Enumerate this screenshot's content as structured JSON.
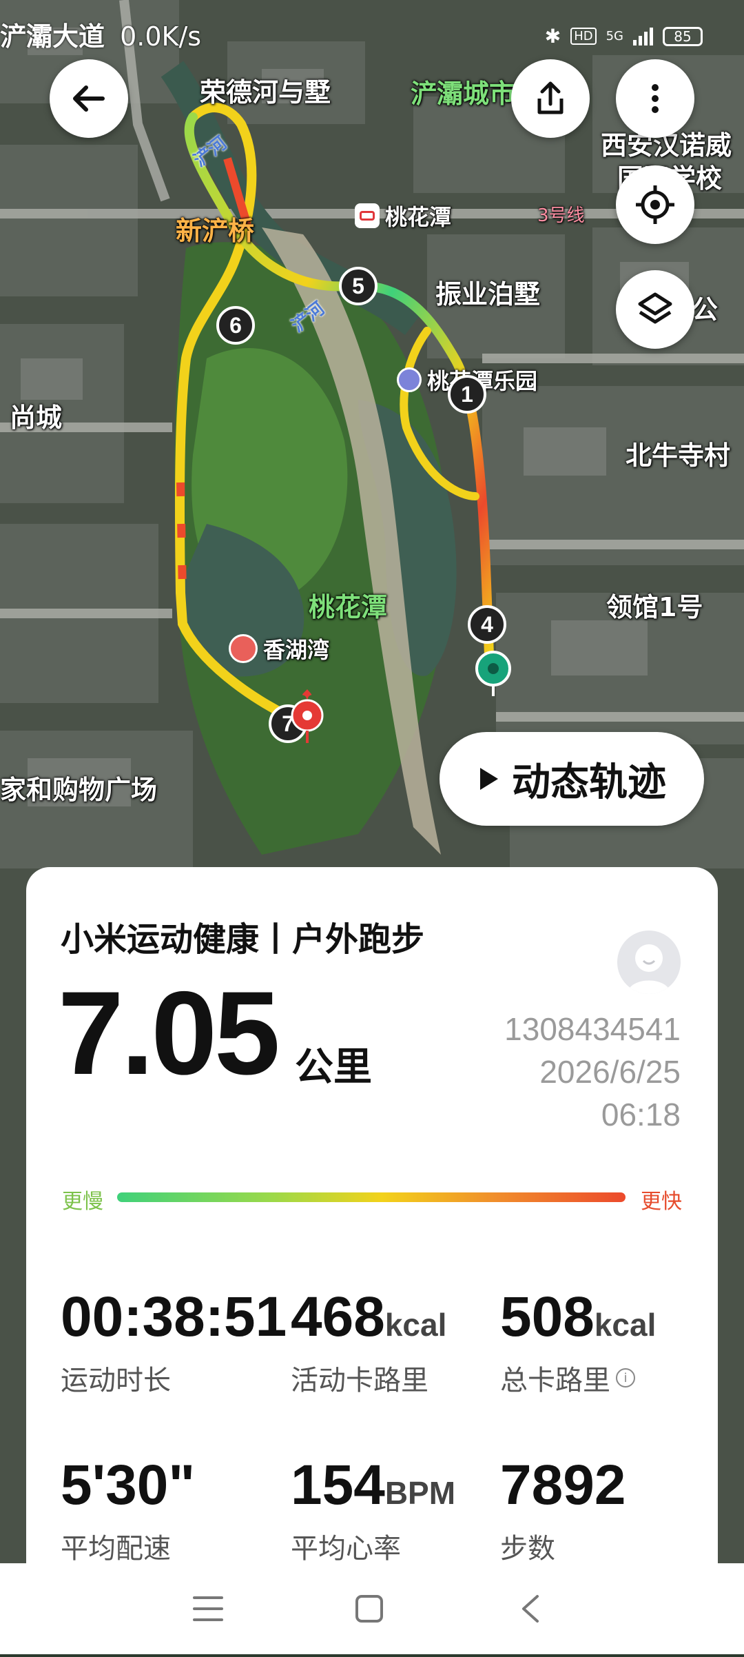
{
  "status_bar": {
    "network_speed": "0.0K/s",
    "network_type": "HD",
    "signal_type": "5G",
    "battery": "85",
    "left_map_text": "浐灞大道"
  },
  "map": {
    "labels": {
      "ronghe": "荣德河与墅",
      "chanba_city": "浐灞城市花园",
      "xian_school": "西安汉诺威",
      "xian_school_2": "国际学校",
      "taohuatan_metro": "桃花潭",
      "line3": "3号线",
      "xinchanqiao": "新浐桥",
      "zhenye": "振业泊墅",
      "paradise": "桃花潭乐园",
      "shangcheng": "尚城",
      "beiniu": "北牛寺村",
      "bai_gong": "白公",
      "taohuatan_park": "桃花潭",
      "lingguan": "领馆1号",
      "xianghuwan": "香湖湾",
      "shopping": "家和购物广场",
      "river1": "浐河",
      "river2": "浐河"
    },
    "markers": [
      "1",
      "4",
      "5",
      "6",
      "7"
    ],
    "colors": {
      "track_slow": "#3fd17a",
      "track_mid": "#f2d21b",
      "track_fast": "#ec4a2c",
      "start_marker": "#17a37a",
      "end_marker": "#e53935"
    }
  },
  "buttons": {
    "back": "arrow-left-icon",
    "share": "share-icon",
    "more": "more-icon",
    "locate": "locate-icon",
    "layers": "layers-icon",
    "dynamic_track": "动态轨迹"
  },
  "card": {
    "title": "小米运动健康丨户外跑步",
    "distance": "7.05",
    "distance_unit": "公里",
    "user_id": "1308434541",
    "date": "2026/6/25",
    "time": "06:18",
    "pace_slow_label": "更慢",
    "pace_fast_label": "更快",
    "stats": [
      {
        "value": "00:38:51",
        "unit": "",
        "label": "运动时长"
      },
      {
        "value": "468",
        "unit": "kcal",
        "label": "活动卡路里"
      },
      {
        "value": "508",
        "unit": "kcal",
        "label": "总卡路里"
      },
      {
        "value": "5'30\"",
        "unit": "",
        "label": "平均配速"
      },
      {
        "value": "154",
        "unit": "BPM",
        "label": "平均心率"
      },
      {
        "value": "7892",
        "unit": "",
        "label": "步数"
      }
    ]
  },
  "nav": {
    "menu": "menu-icon",
    "home": "home-icon",
    "back": "back-icon"
  }
}
